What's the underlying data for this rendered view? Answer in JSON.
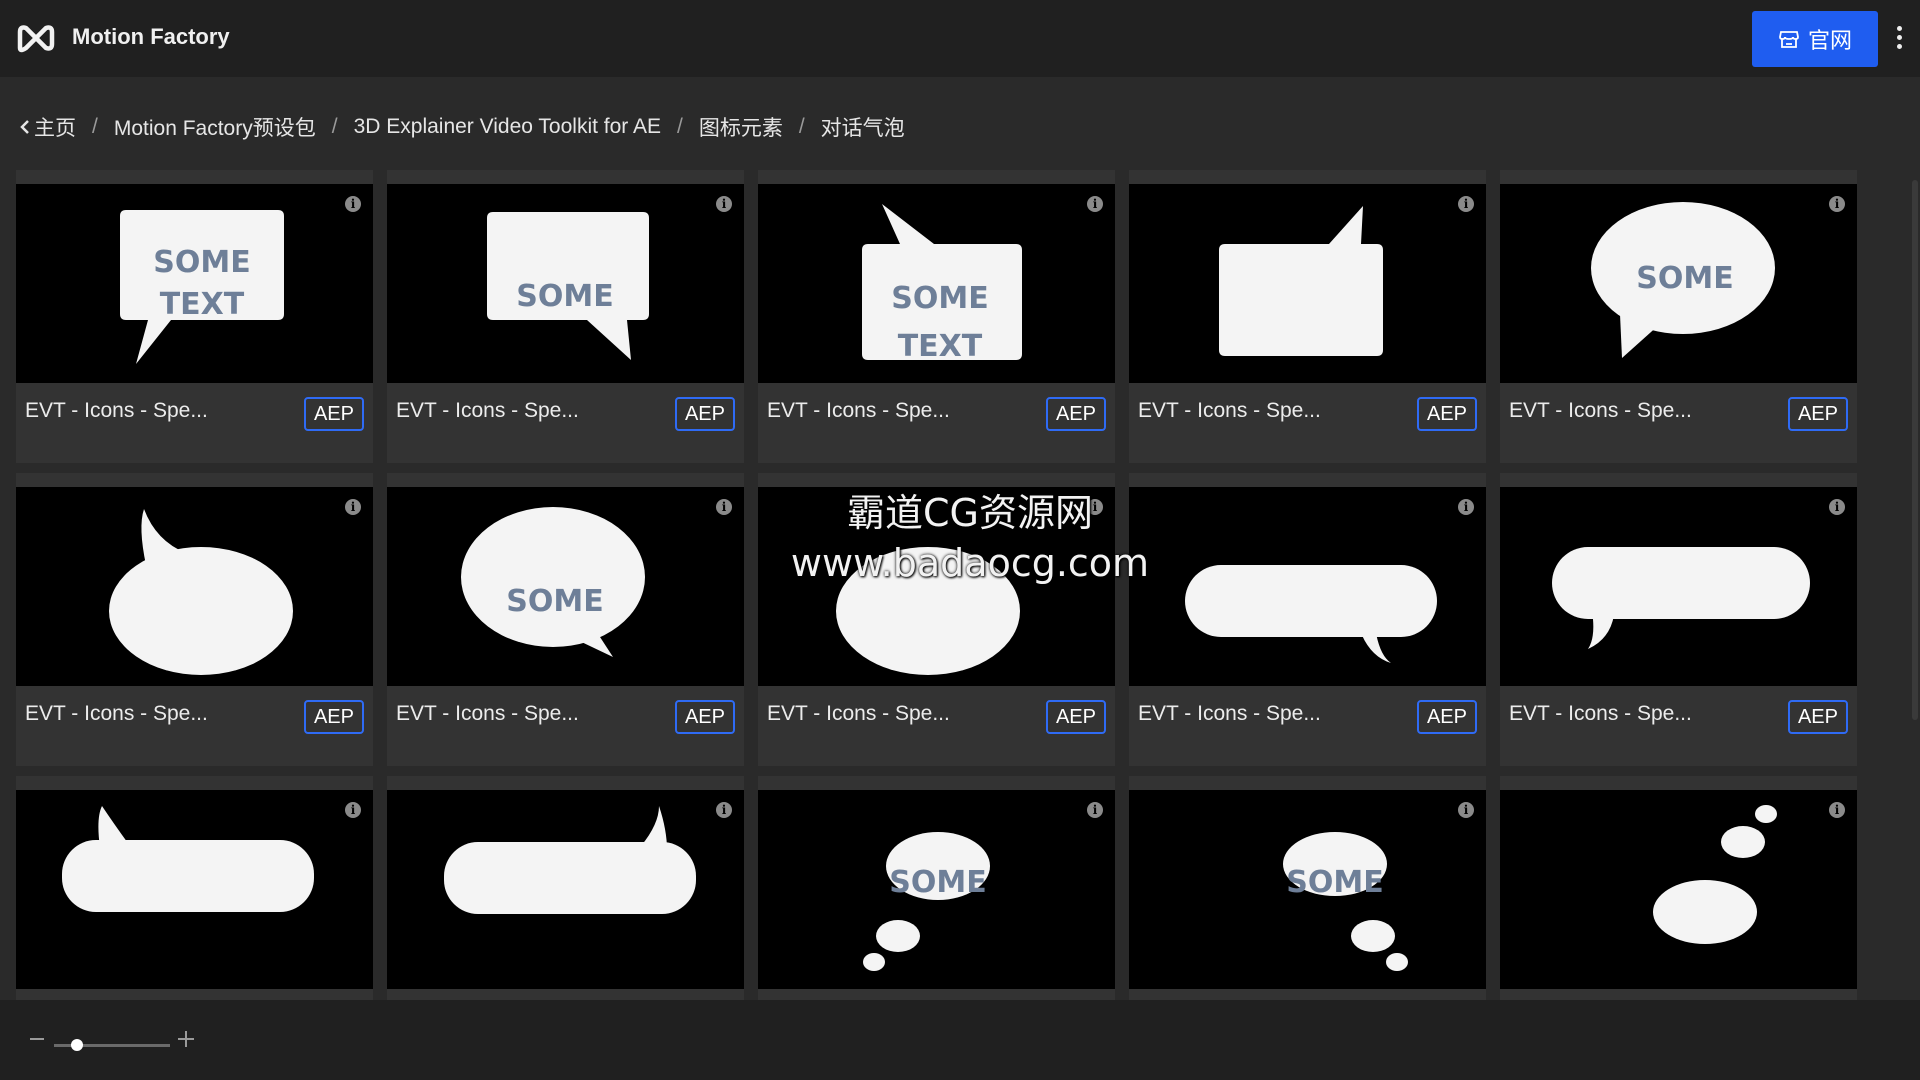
{
  "app": {
    "title": "Motion Factory",
    "site_button_label": "官网"
  },
  "breadcrumb": [
    "主页",
    "Motion Factory预设包",
    "3D Explainer Video Toolkit for AE",
    "图标元素",
    "对话气泡"
  ],
  "items": [
    {
      "title": "EVT - Icons - Spe...",
      "badge": "AEP",
      "shape": "rect-tail-bottom-left",
      "text": [
        "SOME",
        "TEXT"
      ]
    },
    {
      "title": "EVT - Icons - Spe...",
      "badge": "AEP",
      "shape": "rect-tail-bottom-right",
      "text": [
        "SOME"
      ]
    },
    {
      "title": "EVT - Icons - Spe...",
      "badge": "AEP",
      "shape": "rect-tail-top-left",
      "text": [
        "SOME",
        "TEXT"
      ]
    },
    {
      "title": "EVT - Icons - Spe...",
      "badge": "AEP",
      "shape": "rect-tail-top-right",
      "text": []
    },
    {
      "title": "EVT - Icons - Spe...",
      "badge": "AEP",
      "shape": "oval-tail-bottom-left",
      "text": [
        "SOME"
      ]
    },
    {
      "title": "EVT - Icons - Spe...",
      "badge": "AEP",
      "shape": "oval-tail-top-left",
      "text": []
    },
    {
      "title": "EVT - Icons - Spe...",
      "badge": "AEP",
      "shape": "oval-tail-bottom-right",
      "text": [
        "SOME"
      ]
    },
    {
      "title": "EVT - Icons - Spe...",
      "badge": "AEP",
      "shape": "oval-plain",
      "text": []
    },
    {
      "title": "EVT - Icons - Spe...",
      "badge": "AEP",
      "shape": "pill-tail-bottom-right",
      "text": []
    },
    {
      "title": "EVT - Icons - Spe...",
      "badge": "AEP",
      "shape": "pill-tail-bottom-left",
      "text": []
    },
    {
      "title": "",
      "badge": "",
      "shape": "pill-tail-top-left",
      "text": []
    },
    {
      "title": "",
      "badge": "",
      "shape": "pill-tail-top-right",
      "text": []
    },
    {
      "title": "",
      "badge": "",
      "shape": "thought-left",
      "text": [
        "SOME"
      ]
    },
    {
      "title": "",
      "badge": "",
      "shape": "thought-right",
      "text": [
        "SOME"
      ]
    },
    {
      "title": "",
      "badge": "",
      "shape": "thought-up",
      "text": []
    }
  ],
  "watermark": {
    "line1": "霸道CG资源网",
    "line2": "www.badaocg.com"
  },
  "zoom": {
    "level": 0.2
  },
  "colors": {
    "accent": "#1f5df0",
    "badge_border": "#2f6bf5",
    "card_bg": "#333333"
  }
}
